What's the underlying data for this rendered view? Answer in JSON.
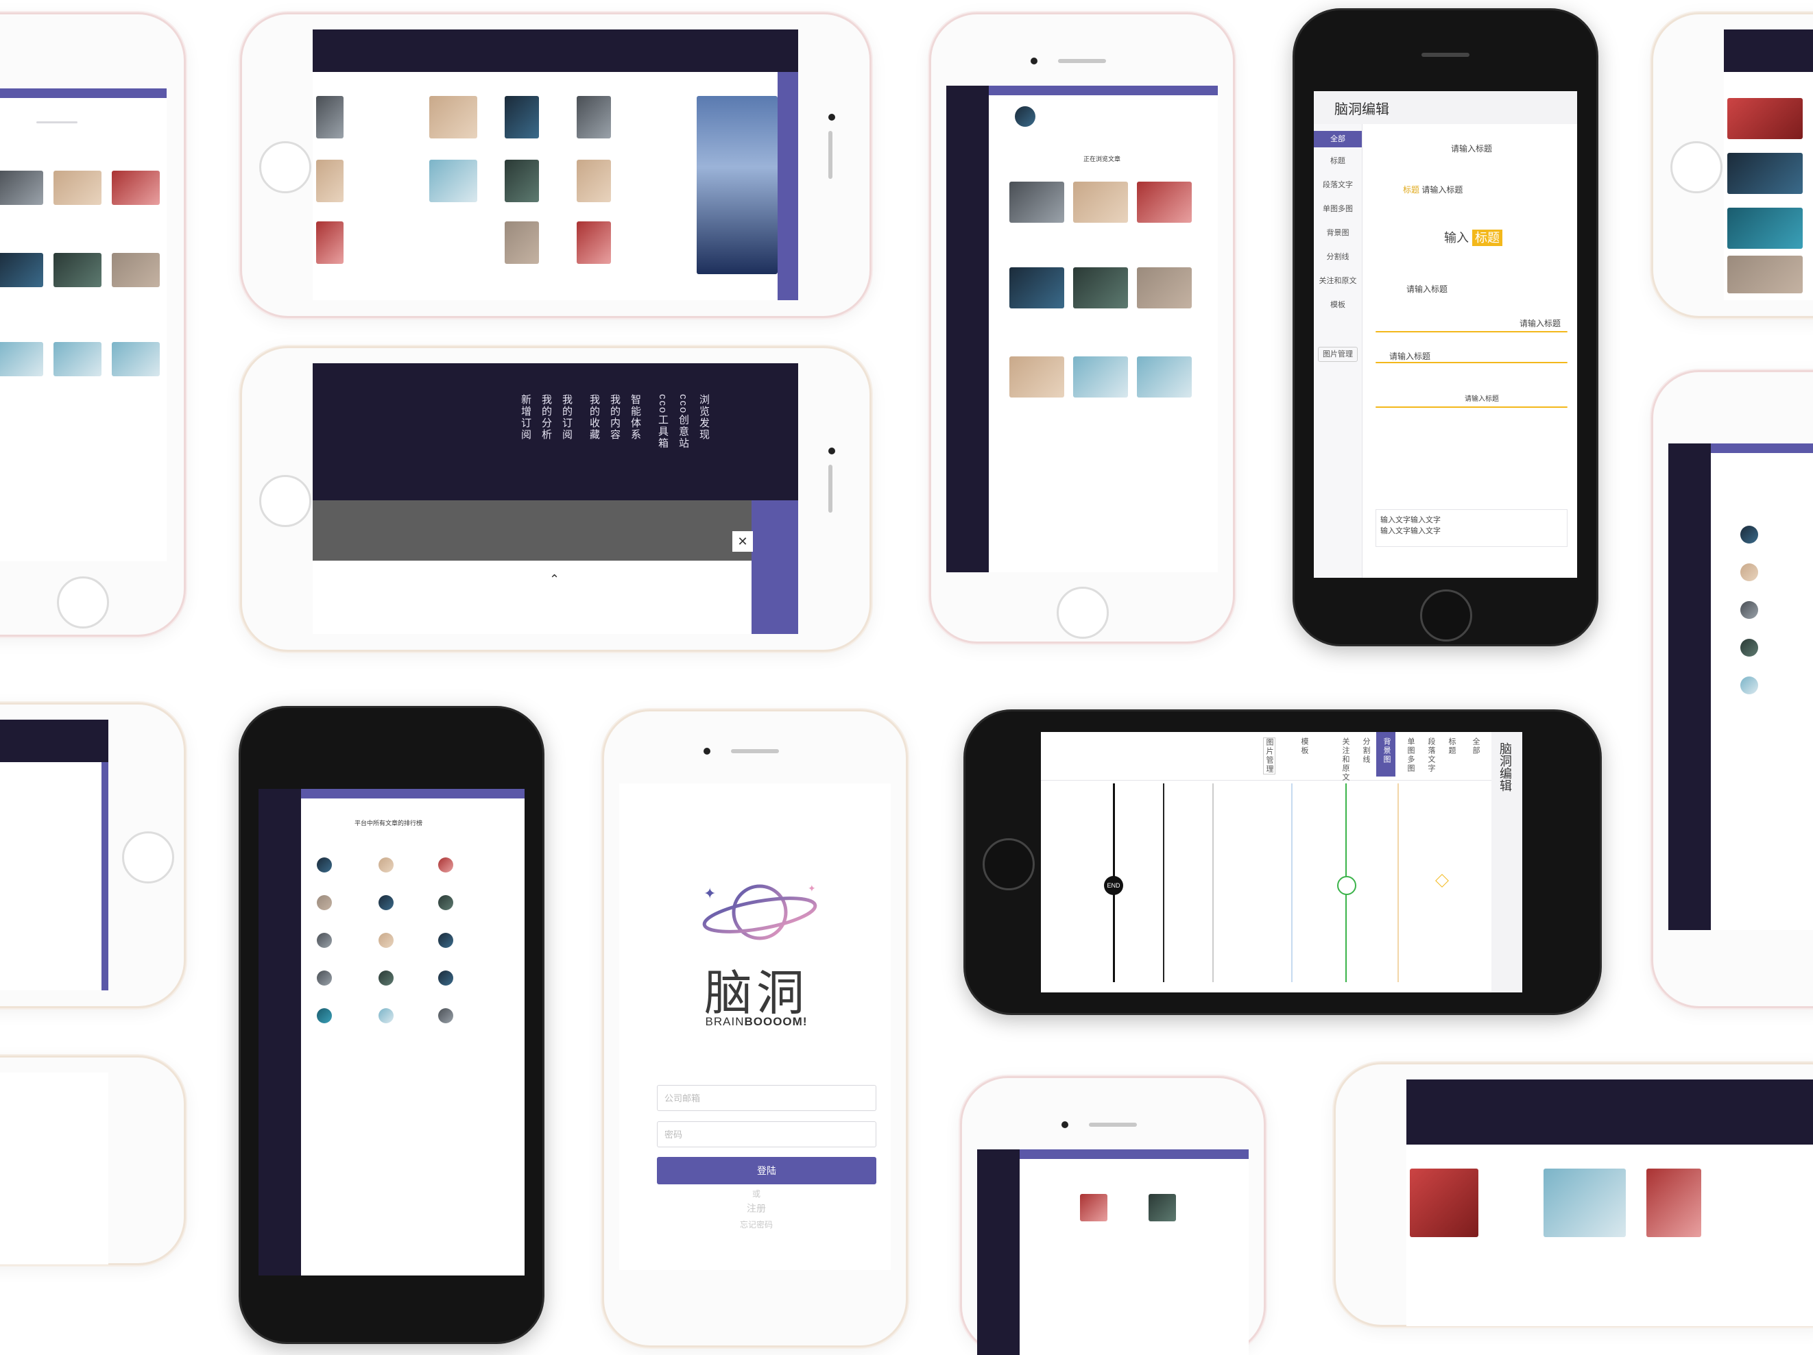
{
  "editor": {
    "title": "脑洞编辑",
    "menu": [
      "全部",
      "标题",
      "段落文字",
      "单图多图",
      "背景图",
      "分割线",
      "关注和原文",
      "模板"
    ],
    "image_manage": "图片管理",
    "samples": {
      "title_input": "请输入标题",
      "tag_heading": "标题",
      "input_prefix": "输入",
      "input_word": "标题",
      "body_text_1": "输入文字输入文字",
      "body_text_2": "输入文字输入文字"
    }
  },
  "login": {
    "logo_cn": "脑洞",
    "logo_en_light": "BRAIN",
    "logo_en_bold": "BOOOOM!",
    "account_placeholder": "公司邮箱",
    "password_placeholder": "密码",
    "login_button": "登陆",
    "or": "或",
    "register": "注册",
    "forgot": "忘记密码"
  },
  "dashboard": {
    "heading": "正在浏览文章",
    "list_heading": "平台中所有文章的排行榜"
  },
  "nav_menu": {
    "items": [
      "浏览发现",
      "cco创意站",
      "cco工具箱",
      "智能体系",
      "我的内容",
      "我的收藏",
      "我的订阅",
      "我的分析",
      "新增订阅"
    ],
    "close": "✕"
  },
  "landscape_editor": {
    "title": "脑洞编辑",
    "tabs": [
      "全部",
      "标题",
      "段落文字",
      "单图多图",
      "背景图",
      "分割线",
      "关注和原文",
      "模板",
      "图片管理"
    ],
    "end_label": "END"
  },
  "colors": {
    "accent": "#5b58a8",
    "sidebar": "#1e1a33",
    "highlight": "#f3b81b",
    "green": "#3bb34a"
  }
}
